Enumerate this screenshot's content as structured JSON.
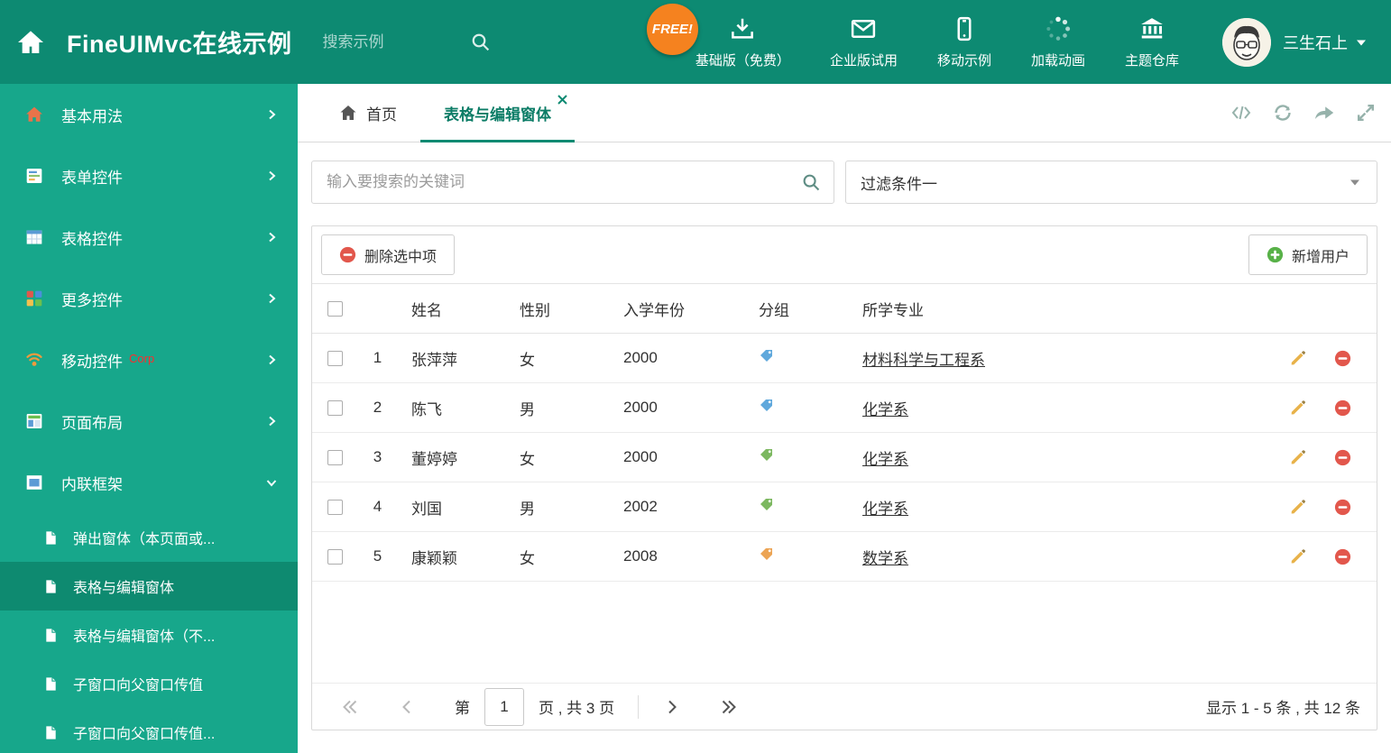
{
  "colors": {
    "header_bg": "#0d8a72",
    "sidebar_bg": "#17a78b",
    "sidebar_selected_bg": "#0e8a70",
    "accent": "#0d8a72",
    "free_badge_bg": "#f5821f",
    "corp_badge": "#ff2b2b",
    "delete_red": "#e2574c",
    "add_green": "#58b148",
    "pencil_gold": "#e8b24a",
    "tag_blue": "#5fa8dc",
    "tag_green": "#7cb860",
    "tag_orange": "#eca454"
  },
  "header": {
    "logo": {
      "title": "FineUIMvc在线示例",
      "icon": "home-icon"
    },
    "search": {
      "placeholder": "搜索示例",
      "icon": "search-icon"
    },
    "free_badge": "FREE!",
    "nav": [
      {
        "label": "基础版（免费）",
        "icon": "download-icon"
      },
      {
        "label": "企业版试用",
        "icon": "envelope-icon"
      },
      {
        "label": "移动示例",
        "icon": "mobile-icon"
      },
      {
        "label": "加载动画",
        "icon": "spinner-icon"
      },
      {
        "label": "主题仓库",
        "icon": "bank-icon"
      }
    ],
    "user": {
      "name": "三生石上",
      "icon": "avatar",
      "caret": "chevron-down-icon"
    }
  },
  "sidebar": {
    "items": [
      {
        "label": "基本用法",
        "icon": "house-icon"
      },
      {
        "label": "表单控件",
        "icon": "form-icon"
      },
      {
        "label": "表格控件",
        "icon": "table-icon"
      },
      {
        "label": "更多控件",
        "icon": "blocks-icon"
      },
      {
        "label": "移动控件",
        "icon": "signal-icon",
        "badge": "Corp"
      },
      {
        "label": "页面布局",
        "icon": "layout-icon"
      },
      {
        "label": "内联框架",
        "icon": "frame-icon",
        "expanded": true
      }
    ],
    "subitems": [
      {
        "label": "弹出窗体（本页面或...",
        "icon": "page-icon"
      },
      {
        "label": "表格与编辑窗体",
        "icon": "page-icon",
        "selected": true
      },
      {
        "label": "表格与编辑窗体（不...",
        "icon": "page-icon"
      },
      {
        "label": "子窗口向父窗口传值",
        "icon": "page-icon"
      },
      {
        "label": "子窗口向父窗口传值...",
        "icon": "page-icon"
      }
    ]
  },
  "tabs": {
    "items": [
      {
        "label": "首页",
        "icon": "home-icon",
        "active": false
      },
      {
        "label": "表格与编辑窗体",
        "active": true,
        "closable": true
      }
    ],
    "tools": [
      "code-icon",
      "refresh-icon",
      "share-icon",
      "expand-icon"
    ]
  },
  "filter": {
    "search_placeholder": "输入要搜索的关键词",
    "dropdown_value": "过滤条件一"
  },
  "toolbar": {
    "delete_label": "删除选中项",
    "add_label": "新增用户"
  },
  "grid": {
    "headers": [
      "姓名",
      "性别",
      "入学年份",
      "分组",
      "所学专业"
    ],
    "rows": [
      {
        "num": "1",
        "name": "张萍萍",
        "gender": "女",
        "year": "2000",
        "tag_color": "blue",
        "major": "材料科学与工程系"
      },
      {
        "num": "2",
        "name": "陈飞",
        "gender": "男",
        "year": "2000",
        "tag_color": "blue",
        "major": "化学系"
      },
      {
        "num": "3",
        "name": "董婷婷",
        "gender": "女",
        "year": "2000",
        "tag_color": "green",
        "major": "化学系"
      },
      {
        "num": "4",
        "name": "刘国",
        "gender": "男",
        "year": "2002",
        "tag_color": "green",
        "major": "化学系"
      },
      {
        "num": "5",
        "name": "康颖颖",
        "gender": "女",
        "year": "2008",
        "tag_color": "orange",
        "major": "数学系"
      }
    ]
  },
  "pagination": {
    "prefix": "第",
    "page": "1",
    "suffix": "页 , 共 3 页",
    "summary": "显示 1 - 5 条 , 共 12 条"
  }
}
